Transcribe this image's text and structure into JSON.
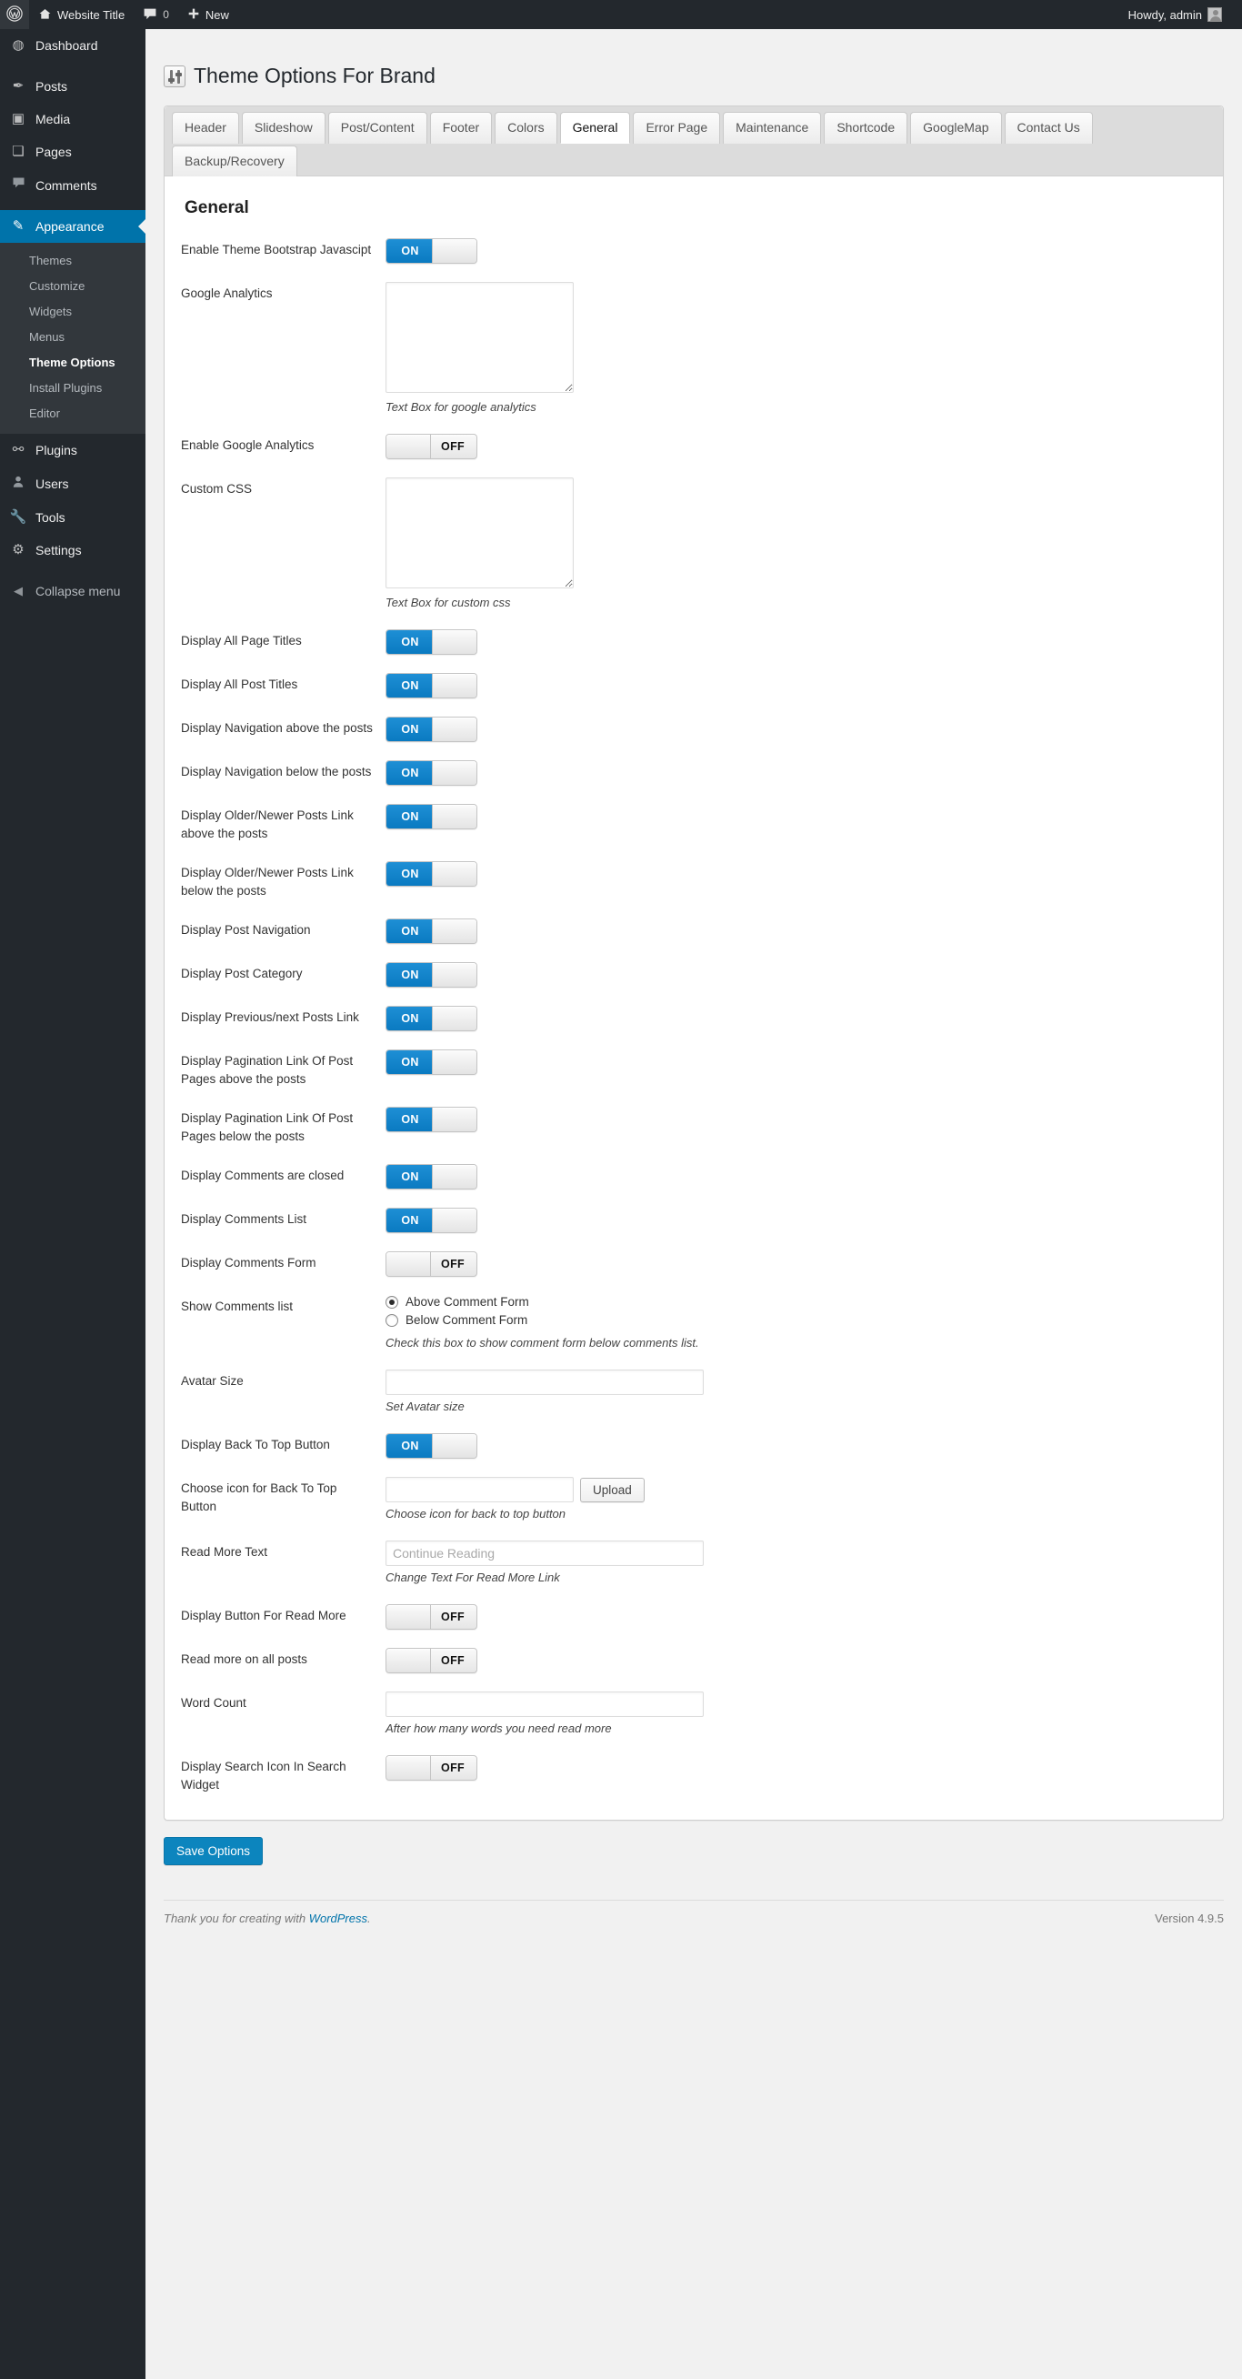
{
  "adminbar": {
    "wp_logo": "wordpress-logo",
    "site_title": "Website Title",
    "comment_count": "0",
    "new_label": "New",
    "howdy": "Howdy, admin"
  },
  "sidebar": {
    "items": [
      {
        "label": "Dashboard",
        "icon": "dashboard-icon",
        "glyph": "◍",
        "current": false
      },
      {
        "label": "Posts",
        "icon": "pin-icon",
        "glyph": "✒",
        "current": false
      },
      {
        "label": "Media",
        "icon": "media-icon",
        "glyph": "▣",
        "current": false
      },
      {
        "label": "Pages",
        "icon": "pages-icon",
        "glyph": "❏",
        "current": false
      },
      {
        "label": "Comments",
        "icon": "comment-icon",
        "glyph": "🗩",
        "current": false
      },
      {
        "label": "Appearance",
        "icon": "brush-icon",
        "glyph": "✎",
        "current": true
      },
      {
        "label": "Plugins",
        "icon": "plug-icon",
        "glyph": "⚯",
        "current": false
      },
      {
        "label": "Users",
        "icon": "user-icon",
        "glyph": "👤",
        "current": false
      },
      {
        "label": "Tools",
        "icon": "wrench-icon",
        "glyph": "🔧",
        "current": false
      },
      {
        "label": "Settings",
        "icon": "settings-icon",
        "glyph": "⚙",
        "current": false
      }
    ],
    "submenu": [
      {
        "label": "Themes",
        "current": false
      },
      {
        "label": "Customize",
        "current": false
      },
      {
        "label": "Widgets",
        "current": false
      },
      {
        "label": "Menus",
        "current": false
      },
      {
        "label": "Theme Options",
        "current": true
      },
      {
        "label": "Install Plugins",
        "current": false
      },
      {
        "label": "Editor",
        "current": false
      }
    ],
    "collapse": {
      "label": "Collapse menu",
      "icon": "collapse-icon",
      "glyph": "◀"
    }
  },
  "page": {
    "title": "Theme Options For Brand",
    "title_icon": "sliders-icon"
  },
  "tabs": {
    "row1": [
      {
        "label": "Header",
        "active": false
      },
      {
        "label": "Slideshow",
        "active": false
      },
      {
        "label": "Post/Content",
        "active": false
      },
      {
        "label": "Footer",
        "active": false
      },
      {
        "label": "Colors",
        "active": false
      },
      {
        "label": "General",
        "active": true
      },
      {
        "label": "Error Page",
        "active": false
      },
      {
        "label": "Maintenance",
        "active": false
      },
      {
        "label": "Shortcode",
        "active": false
      },
      {
        "label": "GoogleMap",
        "active": false
      },
      {
        "label": "Contact Us",
        "active": false
      }
    ],
    "row2": [
      {
        "label": "Backup/Recovery",
        "active": false
      }
    ]
  },
  "section": {
    "heading": "General"
  },
  "options": [
    {
      "name": "enable-theme-bootstrap-javascipt",
      "label": "Enable Theme Bootstrap Javascipt",
      "type": "toggle",
      "value": "ON"
    },
    {
      "name": "google-analytics",
      "label": "Google Analytics",
      "type": "textarea",
      "value": "",
      "desc": "Text Box for google analytics"
    },
    {
      "name": "enable-google-analytics",
      "label": "Enable Google Analytics",
      "type": "toggle",
      "value": "OFF"
    },
    {
      "name": "custom-css",
      "label": "Custom CSS",
      "type": "textarea",
      "value": "",
      "desc": "Text Box for custom css"
    },
    {
      "name": "display-all-page-titles",
      "label": "Display All Page Titles",
      "type": "toggle",
      "value": "ON"
    },
    {
      "name": "display-all-post-titles",
      "label": "Display All Post Titles",
      "type": "toggle",
      "value": "ON"
    },
    {
      "name": "display-navigation-above-the-posts",
      "label": "Display Navigation above the posts",
      "type": "toggle",
      "value": "ON"
    },
    {
      "name": "display-navigation-below-the-posts",
      "label": "Display Navigation below the posts",
      "type": "toggle",
      "value": "ON"
    },
    {
      "name": "display-older-newer-posts-link-above-the-posts",
      "label": "Display Older/Newer Posts Link above the posts",
      "type": "toggle",
      "value": "ON"
    },
    {
      "name": "display-older-newer-posts-link-below-the-posts",
      "label": "Display Older/Newer Posts Link below the posts",
      "type": "toggle",
      "value": "ON"
    },
    {
      "name": "display-post-navigation",
      "label": "Display Post Navigation",
      "type": "toggle",
      "value": "ON"
    },
    {
      "name": "display-post-category",
      "label": "Display Post Category",
      "type": "toggle",
      "value": "ON"
    },
    {
      "name": "display-previous-next-posts-link",
      "label": "Display Previous/next Posts Link",
      "type": "toggle",
      "value": "ON"
    },
    {
      "name": "display-pagination-link-of-post-pages-above-the-posts",
      "label": "Display Pagination Link Of Post Pages above the posts",
      "type": "toggle",
      "value": "ON"
    },
    {
      "name": "display-pagination-link-of-post-pages-below-the-posts",
      "label": "Display Pagination Link Of Post Pages below the posts",
      "type": "toggle",
      "value": "ON"
    },
    {
      "name": "display-comments-are-closed",
      "label": "Display Comments are closed",
      "type": "toggle",
      "value": "ON"
    },
    {
      "name": "display-comments-list",
      "label": "Display Comments List",
      "type": "toggle",
      "value": "ON"
    },
    {
      "name": "display-comments-form",
      "label": "Display Comments Form",
      "type": "toggle",
      "value": "OFF"
    },
    {
      "name": "show-comments-list",
      "label": "Show Comments list",
      "type": "radio",
      "desc": "Check this box to show comment form below comments list.",
      "radios": [
        {
          "label": "Above Comment Form",
          "checked": true
        },
        {
          "label": "Below Comment Form",
          "checked": false
        }
      ]
    },
    {
      "name": "avatar-size",
      "label": "Avatar Size",
      "type": "text",
      "value": "",
      "placeholder": "",
      "desc": "Set Avatar size"
    },
    {
      "name": "display-back-to-top-button",
      "label": "Display Back To Top Button",
      "type": "toggle",
      "value": "ON"
    },
    {
      "name": "choose-icon-for-back-to-top-button",
      "label": "Choose icon for Back To Top Button",
      "type": "upload",
      "value": "",
      "button": "Upload",
      "desc": "Choose icon for back to top button"
    },
    {
      "name": "read-more-text",
      "label": "Read More Text",
      "type": "text",
      "value": "",
      "placeholder": "Continue Reading",
      "desc": "Change Text For Read More Link"
    },
    {
      "name": "display-button-for-read-more",
      "label": "Display Button For Read More",
      "type": "toggle",
      "value": "OFF"
    },
    {
      "name": "read-more-on-all-posts",
      "label": "Read more on all posts",
      "type": "toggle",
      "value": "OFF"
    },
    {
      "name": "word-count",
      "label": "Word Count",
      "type": "text",
      "value": "",
      "placeholder": "",
      "desc": "After how many words you need read more"
    },
    {
      "name": "display-search-icon-in-search-widget",
      "label": "Display Search Icon In Search Widget",
      "type": "toggle",
      "value": "OFF"
    }
  ],
  "save": {
    "label": "Save Options"
  },
  "footer": {
    "thanks_prefix": "Thank you for creating with ",
    "link": "WordPress",
    "thanks_suffix": ".",
    "version": "Version 4.9.5"
  },
  "colors": {
    "accent": "#0073aa",
    "toggle_on": "#1e8fd5",
    "sidebar_bg": "#23282d",
    "submenu_bg": "#32373c",
    "save_button": "#0c85be"
  }
}
